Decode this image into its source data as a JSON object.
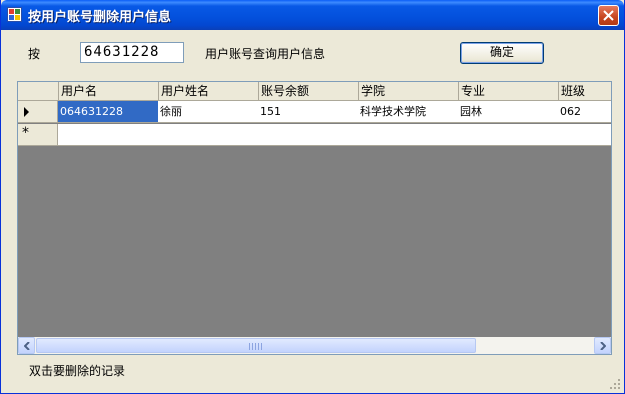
{
  "window": {
    "title": "按用户账号删除用户信息",
    "colors": {
      "titlebar": "#0350dc",
      "selection": "#316ac5",
      "grid_background": "#808080",
      "face": "#ece9d8"
    }
  },
  "search": {
    "prefix_label": "按",
    "account_value": "64631228",
    "suffix_label": "用户账号查询用户信息",
    "confirm_label": "确定"
  },
  "grid": {
    "columns": [
      "用户名",
      "用户姓名",
      "账号余额",
      "学院",
      "专业",
      "班级"
    ],
    "rows": [
      [
        "064631228",
        "徐丽",
        "151",
        "科学技术学院",
        "园林",
        "062"
      ]
    ],
    "current_row_marker": "arrow-right",
    "new_row_marker": "*"
  },
  "footer": {
    "hint": "双击要删除的记录"
  }
}
